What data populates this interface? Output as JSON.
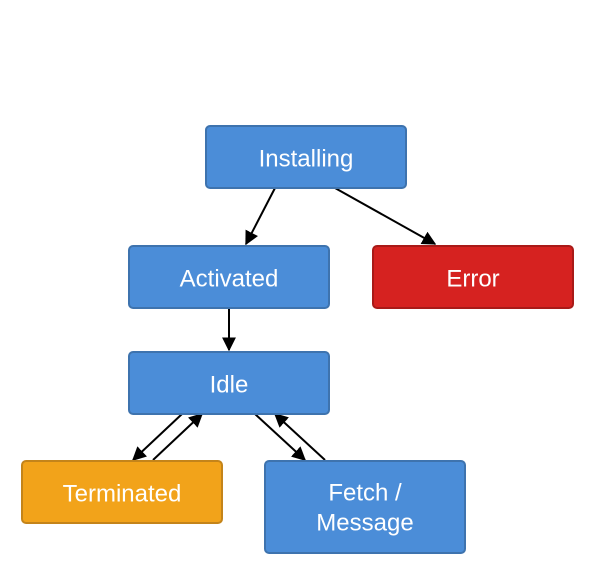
{
  "diagram": {
    "nodes": {
      "installing": {
        "label": "Installing",
        "color": "#4B8DD8",
        "stroke": "#3E73AE"
      },
      "activated": {
        "label": "Activated",
        "color": "#4B8DD8",
        "stroke": "#3E73AE"
      },
      "error": {
        "label": "Error",
        "color": "#D62220",
        "stroke": "#A91A18"
      },
      "idle": {
        "label": "Idle",
        "color": "#4B8DD8",
        "stroke": "#3E73AE"
      },
      "terminated": {
        "label": "Terminated",
        "color": "#F2A31A",
        "stroke": "#C4841A"
      },
      "fetch_l1": {
        "label": "Fetch /",
        "color": "#4B8DD8",
        "stroke": "#3E73AE"
      },
      "fetch_l2": {
        "label": "Message"
      }
    },
    "edges": [
      "installing→activated",
      "installing→error",
      "activated→idle",
      "idle↔terminated",
      "idle↔fetch/message"
    ]
  }
}
